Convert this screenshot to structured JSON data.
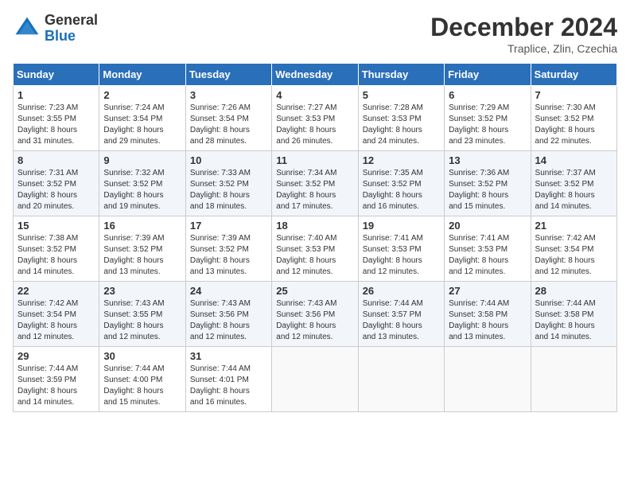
{
  "header": {
    "logo_general": "General",
    "logo_blue": "Blue",
    "month_title": "December 2024",
    "location": "Traplice, Zlin, Czechia"
  },
  "weekdays": [
    "Sunday",
    "Monday",
    "Tuesday",
    "Wednesday",
    "Thursday",
    "Friday",
    "Saturday"
  ],
  "weeks": [
    [
      {
        "day": "1",
        "info": "Sunrise: 7:23 AM\nSunset: 3:55 PM\nDaylight: 8 hours\nand 31 minutes."
      },
      {
        "day": "2",
        "info": "Sunrise: 7:24 AM\nSunset: 3:54 PM\nDaylight: 8 hours\nand 29 minutes."
      },
      {
        "day": "3",
        "info": "Sunrise: 7:26 AM\nSunset: 3:54 PM\nDaylight: 8 hours\nand 28 minutes."
      },
      {
        "day": "4",
        "info": "Sunrise: 7:27 AM\nSunset: 3:53 PM\nDaylight: 8 hours\nand 26 minutes."
      },
      {
        "day": "5",
        "info": "Sunrise: 7:28 AM\nSunset: 3:53 PM\nDaylight: 8 hours\nand 24 minutes."
      },
      {
        "day": "6",
        "info": "Sunrise: 7:29 AM\nSunset: 3:52 PM\nDaylight: 8 hours\nand 23 minutes."
      },
      {
        "day": "7",
        "info": "Sunrise: 7:30 AM\nSunset: 3:52 PM\nDaylight: 8 hours\nand 22 minutes."
      }
    ],
    [
      {
        "day": "8",
        "info": "Sunrise: 7:31 AM\nSunset: 3:52 PM\nDaylight: 8 hours\nand 20 minutes."
      },
      {
        "day": "9",
        "info": "Sunrise: 7:32 AM\nSunset: 3:52 PM\nDaylight: 8 hours\nand 19 minutes."
      },
      {
        "day": "10",
        "info": "Sunrise: 7:33 AM\nSunset: 3:52 PM\nDaylight: 8 hours\nand 18 minutes."
      },
      {
        "day": "11",
        "info": "Sunrise: 7:34 AM\nSunset: 3:52 PM\nDaylight: 8 hours\nand 17 minutes."
      },
      {
        "day": "12",
        "info": "Sunrise: 7:35 AM\nSunset: 3:52 PM\nDaylight: 8 hours\nand 16 minutes."
      },
      {
        "day": "13",
        "info": "Sunrise: 7:36 AM\nSunset: 3:52 PM\nDaylight: 8 hours\nand 15 minutes."
      },
      {
        "day": "14",
        "info": "Sunrise: 7:37 AM\nSunset: 3:52 PM\nDaylight: 8 hours\nand 14 minutes."
      }
    ],
    [
      {
        "day": "15",
        "info": "Sunrise: 7:38 AM\nSunset: 3:52 PM\nDaylight: 8 hours\nand 14 minutes."
      },
      {
        "day": "16",
        "info": "Sunrise: 7:39 AM\nSunset: 3:52 PM\nDaylight: 8 hours\nand 13 minutes."
      },
      {
        "day": "17",
        "info": "Sunrise: 7:39 AM\nSunset: 3:52 PM\nDaylight: 8 hours\nand 13 minutes."
      },
      {
        "day": "18",
        "info": "Sunrise: 7:40 AM\nSunset: 3:53 PM\nDaylight: 8 hours\nand 12 minutes."
      },
      {
        "day": "19",
        "info": "Sunrise: 7:41 AM\nSunset: 3:53 PM\nDaylight: 8 hours\nand 12 minutes."
      },
      {
        "day": "20",
        "info": "Sunrise: 7:41 AM\nSunset: 3:53 PM\nDaylight: 8 hours\nand 12 minutes."
      },
      {
        "day": "21",
        "info": "Sunrise: 7:42 AM\nSunset: 3:54 PM\nDaylight: 8 hours\nand 12 minutes."
      }
    ],
    [
      {
        "day": "22",
        "info": "Sunrise: 7:42 AM\nSunset: 3:54 PM\nDaylight: 8 hours\nand 12 minutes."
      },
      {
        "day": "23",
        "info": "Sunrise: 7:43 AM\nSunset: 3:55 PM\nDaylight: 8 hours\nand 12 minutes."
      },
      {
        "day": "24",
        "info": "Sunrise: 7:43 AM\nSunset: 3:56 PM\nDaylight: 8 hours\nand 12 minutes."
      },
      {
        "day": "25",
        "info": "Sunrise: 7:43 AM\nSunset: 3:56 PM\nDaylight: 8 hours\nand 12 minutes."
      },
      {
        "day": "26",
        "info": "Sunrise: 7:44 AM\nSunset: 3:57 PM\nDaylight: 8 hours\nand 13 minutes."
      },
      {
        "day": "27",
        "info": "Sunrise: 7:44 AM\nSunset: 3:58 PM\nDaylight: 8 hours\nand 13 minutes."
      },
      {
        "day": "28",
        "info": "Sunrise: 7:44 AM\nSunset: 3:58 PM\nDaylight: 8 hours\nand 14 minutes."
      }
    ],
    [
      {
        "day": "29",
        "info": "Sunrise: 7:44 AM\nSunset: 3:59 PM\nDaylight: 8 hours\nand 14 minutes."
      },
      {
        "day": "30",
        "info": "Sunrise: 7:44 AM\nSunset: 4:00 PM\nDaylight: 8 hours\nand 15 minutes."
      },
      {
        "day": "31",
        "info": "Sunrise: 7:44 AM\nSunset: 4:01 PM\nDaylight: 8 hours\nand 16 minutes."
      },
      {
        "day": "",
        "info": ""
      },
      {
        "day": "",
        "info": ""
      },
      {
        "day": "",
        "info": ""
      },
      {
        "day": "",
        "info": ""
      }
    ]
  ]
}
